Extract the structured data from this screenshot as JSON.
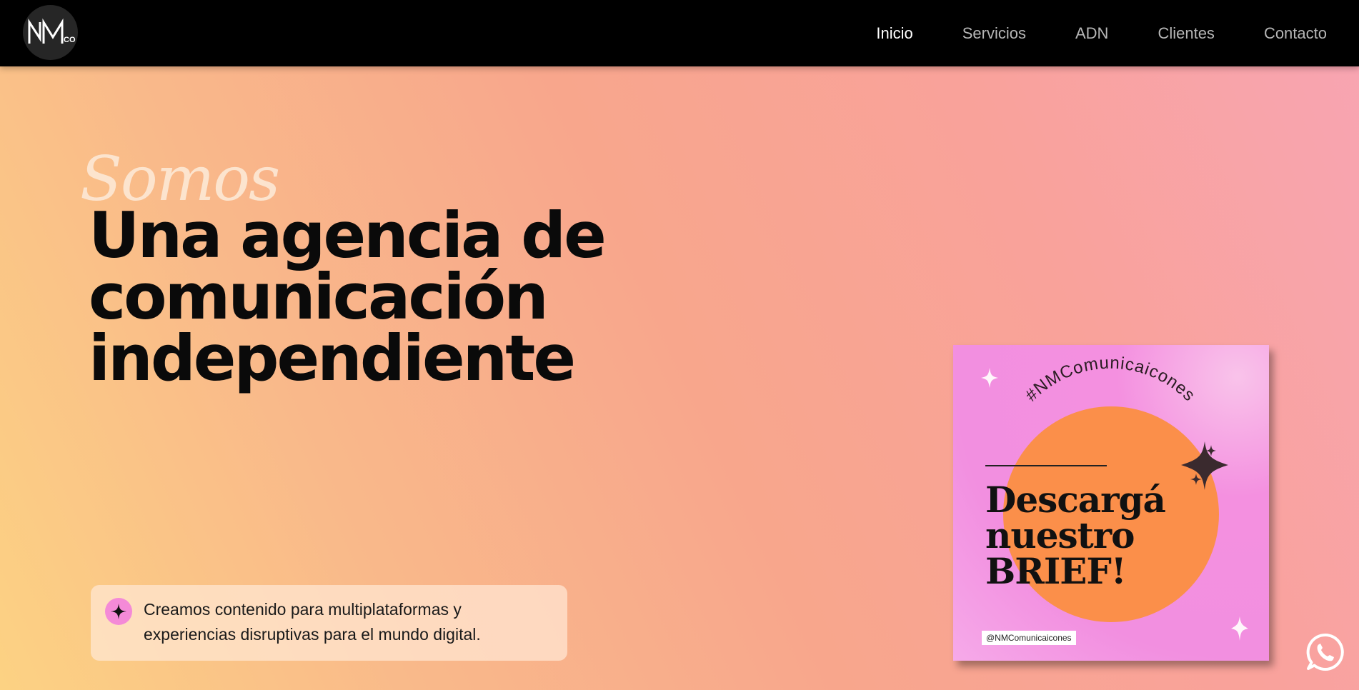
{
  "header": {
    "logo_alt": "NM CO",
    "nav": [
      {
        "label": "Inicio",
        "active": true
      },
      {
        "label": "Servicios",
        "active": false
      },
      {
        "label": "ADN",
        "active": false
      },
      {
        "label": "Clientes",
        "active": false
      },
      {
        "label": "Contacto",
        "active": false
      }
    ]
  },
  "hero": {
    "eyebrow": "Somos",
    "headline_lines": [
      "Una agencia de",
      "comunicación",
      "independiente"
    ],
    "tagline": "Creamos contenido para multiplataformas y experiencias disruptivas para el mundo digital.",
    "tagline_icon": "sparkle-icon"
  },
  "brief_card": {
    "hashtag": "#NMComunicaicones",
    "title_lines": [
      "Descargá",
      "nuestro",
      "BRIEF!"
    ],
    "handle": "@NMComunicaicones"
  },
  "floating": {
    "whatsapp_icon": "whatsapp-icon"
  },
  "colors": {
    "header_bg": "#000000",
    "nav_active": "#ffffff",
    "nav_inactive": "#b6b6b6",
    "headline": "#0a0a0a",
    "card_pink": "#f28fe0",
    "card_orange": "#fb8f4a",
    "icon_pink": "#f48ad7"
  }
}
